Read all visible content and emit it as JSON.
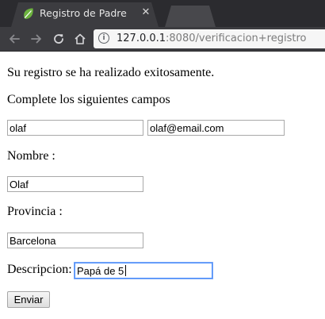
{
  "browser": {
    "tab": {
      "title": "Registro de Padre",
      "close_glyph": "✕"
    },
    "address": {
      "info_glyph": "i",
      "host": "127.0.0.1",
      "rest": ":8080/verificacion+registro"
    },
    "icons": [
      "back-arrow-icon",
      "forward-arrow-icon",
      "reload-icon",
      "home-icon",
      "info-icon",
      "spring-leaf-favicon"
    ]
  },
  "page": {
    "success_message": "Su registro se ha realizado exitosamente.",
    "instructions": "Complete los siguientes campos",
    "username_value": "olaf",
    "email_value": "olaf@email.com",
    "nombre_label": "Nombre :",
    "nombre_value": "Olaf",
    "provincia_label": "Provincia :",
    "provincia_value": "Barcelona",
    "descripcion_label": "Descripcion:",
    "descripcion_value": "Papá de 5",
    "submit_label": "Enviar"
  },
  "colors": {
    "tabstrip": "#2b2b2f",
    "toolbar": "#3c3c40",
    "focus_ring": "#4d90fe"
  }
}
